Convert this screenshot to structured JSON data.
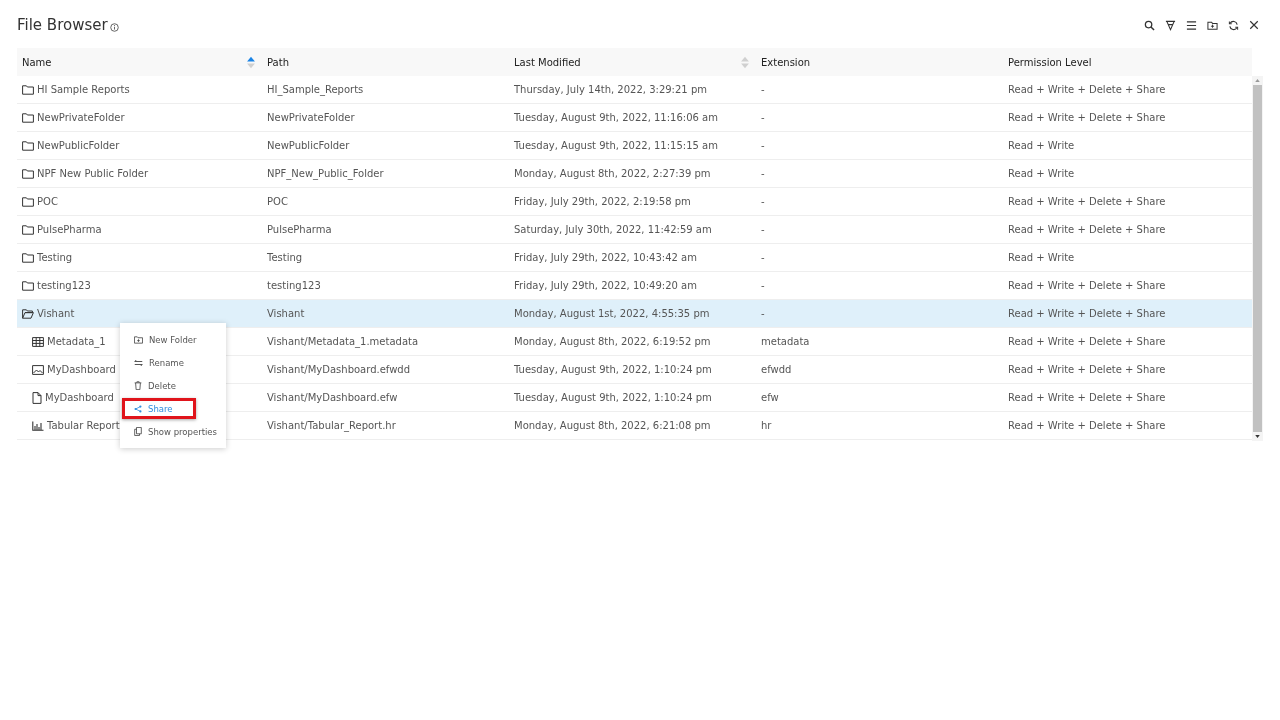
{
  "header": {
    "title": "File Browser"
  },
  "toolbar": [
    {
      "kind": "search"
    },
    {
      "kind": "filter"
    },
    {
      "kind": "menu"
    },
    {
      "kind": "new-folder"
    },
    {
      "kind": "refresh"
    },
    {
      "kind": "close"
    }
  ],
  "table": {
    "columns": [
      {
        "label": "Name",
        "sortable": true,
        "sorted": true
      },
      {
        "label": "Path",
        "sortable": false
      },
      {
        "label": "Last Modified",
        "sortable": true,
        "sorted": false
      },
      {
        "label": "Extension",
        "sortable": false
      },
      {
        "label": "Permission Level",
        "sortable": false
      }
    ],
    "rows": [
      {
        "kind": "folder",
        "name": "HI Sample Reports",
        "path": "HI_Sample_Reports",
        "modified": "Thursday, July 14th, 2022, 3:29:21 pm",
        "extension": "-",
        "permission": "Read + Write + Delete + Share",
        "selected": false
      },
      {
        "kind": "folder",
        "name": "NewPrivateFolder",
        "path": "NewPrivateFolder",
        "modified": "Tuesday, August 9th, 2022, 11:16:06 am",
        "extension": "-",
        "permission": "Read + Write + Delete + Share",
        "selected": false
      },
      {
        "kind": "folder",
        "name": "NewPublicFolder",
        "path": "NewPublicFolder",
        "modified": "Tuesday, August 9th, 2022, 11:15:15 am",
        "extension": "-",
        "permission": "Read + Write",
        "selected": false
      },
      {
        "kind": "folder",
        "name": "NPF New Public Folder",
        "path": "NPF_New_Public_Folder",
        "modified": "Monday, August 8th, 2022, 2:27:39 pm",
        "extension": "-",
        "permission": "Read + Write",
        "selected": false
      },
      {
        "kind": "folder",
        "name": "POC",
        "path": "POC",
        "modified": "Friday, July 29th, 2022, 2:19:58 pm",
        "extension": "-",
        "permission": "Read + Write + Delete + Share",
        "selected": false
      },
      {
        "kind": "folder",
        "name": "PulsePharma",
        "path": "PulsePharma",
        "modified": "Saturday, July 30th, 2022, 11:42:59 am",
        "extension": "-",
        "permission": "Read + Write + Delete + Share",
        "selected": false
      },
      {
        "kind": "folder",
        "name": "Testing",
        "path": "Testing",
        "modified": "Friday, July 29th, 2022, 10:43:42 am",
        "extension": "-",
        "permission": "Read + Write",
        "selected": false
      },
      {
        "kind": "folder",
        "name": "testing123",
        "path": "testing123",
        "modified": "Friday, July 29th, 2022, 10:49:20 am",
        "extension": "-",
        "permission": "Read + Write + Delete + Share",
        "selected": false
      },
      {
        "kind": "folder",
        "name": "Vishant",
        "path": "Vishant",
        "modified": "Monday, August 1st, 2022, 4:55:35 pm",
        "extension": "-",
        "permission": "Read + Write + Delete + Share",
        "selected": true,
        "expanded": true,
        "children": [
          {
            "kind": "table",
            "name": "Metadata_1",
            "path": "Vishant/Metadata_1.metadata",
            "modified": "Monday, August 8th, 2022, 6:19:52 pm",
            "extension": "metadata",
            "permission": "Read + Write + Delete + Share",
            "selected": false
          },
          {
            "kind": "dashboard",
            "name": "MyDashboard",
            "path": "Vishant/MyDashboard.efwdd",
            "modified": "Tuesday, August 9th, 2022, 1:10:24 pm",
            "extension": "efwdd",
            "permission": "Read + Write + Delete + Share",
            "selected": false
          },
          {
            "kind": "file",
            "name": "MyDashboard",
            "path": "Vishant/MyDashboard.efw",
            "modified": "Tuesday, August 9th, 2022, 1:10:24 pm",
            "extension": "efw",
            "permission": "Read + Write + Delete + Share",
            "selected": false
          },
          {
            "kind": "chart",
            "name": "Tabular Report",
            "path": "Vishant/Tabular_Report.hr",
            "modified": "Monday, August 8th, 2022, 6:21:08 pm",
            "extension": "hr",
            "permission": "Read + Write + Delete + Share",
            "selected": false
          }
        ]
      }
    ]
  },
  "context_menu": {
    "items": [
      {
        "kind": "new-folder",
        "label": "New Folder",
        "highlighted": false
      },
      {
        "kind": "rename",
        "label": "Rename",
        "highlighted": false
      },
      {
        "kind": "delete",
        "label": "Delete",
        "highlighted": false
      },
      {
        "kind": "share",
        "label": "Share",
        "highlighted": true
      },
      {
        "kind": "properties",
        "label": "Show properties",
        "highlighted": false
      }
    ]
  }
}
